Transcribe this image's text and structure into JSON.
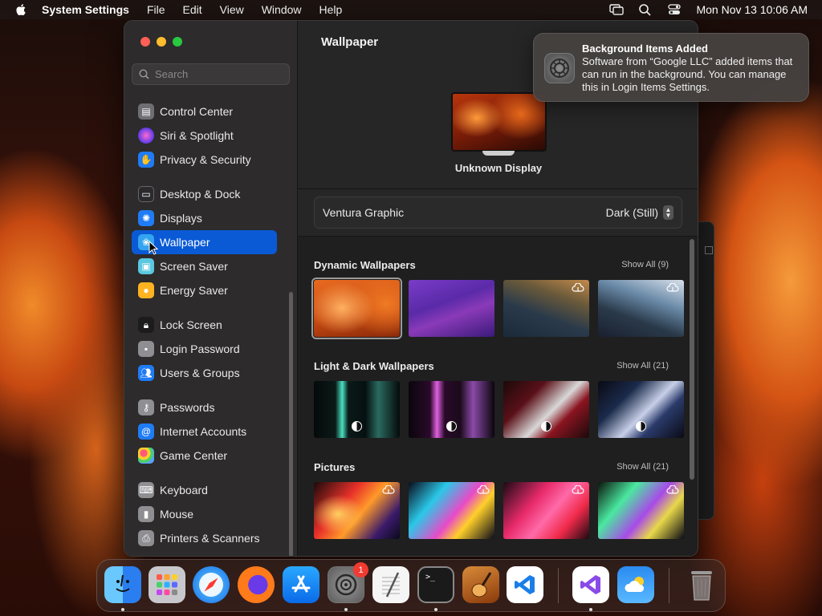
{
  "menubar": {
    "app_name": "System Settings",
    "menus": [
      "File",
      "Edit",
      "View",
      "Window",
      "Help"
    ],
    "clock": "Mon Nov 13  10:06 AM"
  },
  "sidebar": {
    "search_placeholder": "Search",
    "items": [
      {
        "label": "Control Center",
        "icon": "control-center-icon",
        "color": "#6e6e73"
      },
      {
        "label": "Siri & Spotlight",
        "icon": "siri-icon",
        "color": "#b03ad8"
      },
      {
        "label": "Privacy & Security",
        "icon": "hand-icon",
        "color": "#1f7cf5"
      },
      {
        "label": "Desktop & Dock",
        "icon": "desktop-dock-icon",
        "color": "#3a3a3c"
      },
      {
        "label": "Displays",
        "icon": "displays-icon",
        "color": "#1f7cf5"
      },
      {
        "label": "Wallpaper",
        "icon": "wallpaper-icon",
        "color": "#34a4f0"
      },
      {
        "label": "Screen Saver",
        "icon": "screen-saver-icon",
        "color": "#5ac8e0"
      },
      {
        "label": "Energy Saver",
        "icon": "energy-saver-icon",
        "color": "#ffb320"
      },
      {
        "label": "Lock Screen",
        "icon": "lock-icon",
        "color": "#2a2a2a"
      },
      {
        "label": "Login Password",
        "icon": "login-password-icon",
        "color": "#8e8e93"
      },
      {
        "label": "Users & Groups",
        "icon": "users-icon",
        "color": "#1f7cf5"
      },
      {
        "label": "Passwords",
        "icon": "key-icon",
        "color": "#8e8e93"
      },
      {
        "label": "Internet Accounts",
        "icon": "at-icon",
        "color": "#1f7cf5"
      },
      {
        "label": "Game Center",
        "icon": "game-center-icon",
        "color": "#f2f2f2"
      },
      {
        "label": "Keyboard",
        "icon": "keyboard-icon",
        "color": "#8e8e93"
      },
      {
        "label": "Mouse",
        "icon": "mouse-icon",
        "color": "#8e8e93"
      },
      {
        "label": "Printers & Scanners",
        "icon": "printer-icon",
        "color": "#8e8e93"
      }
    ],
    "active": "Wallpaper",
    "accent": "#0a5ad6"
  },
  "main": {
    "title": "Wallpaper",
    "display_name": "Unknown Display",
    "current_wallpaper": "Ventura Graphic",
    "appearance": "Dark (Still)",
    "sections": [
      {
        "title": "Dynamic Wallpapers",
        "show_all": "Show All (9)"
      },
      {
        "title": "Light & Dark Wallpapers",
        "show_all": "Show All (21)"
      },
      {
        "title": "Pictures",
        "show_all": "Show All (21)"
      }
    ]
  },
  "notification": {
    "title": "Background Items Added",
    "body": "Software from “Google LLC” added items that can run in the background. You can manage this in Login Items Settings."
  },
  "dock": {
    "apps": [
      "Finder",
      "Launchpad",
      "Safari",
      "Firefox",
      "App Store",
      "System Settings",
      "TextEdit",
      "Terminal",
      "GarageBand",
      "Visual Studio Code",
      "Visual Studio",
      "Weather",
      "Trash"
    ],
    "settings_badge": "1"
  }
}
